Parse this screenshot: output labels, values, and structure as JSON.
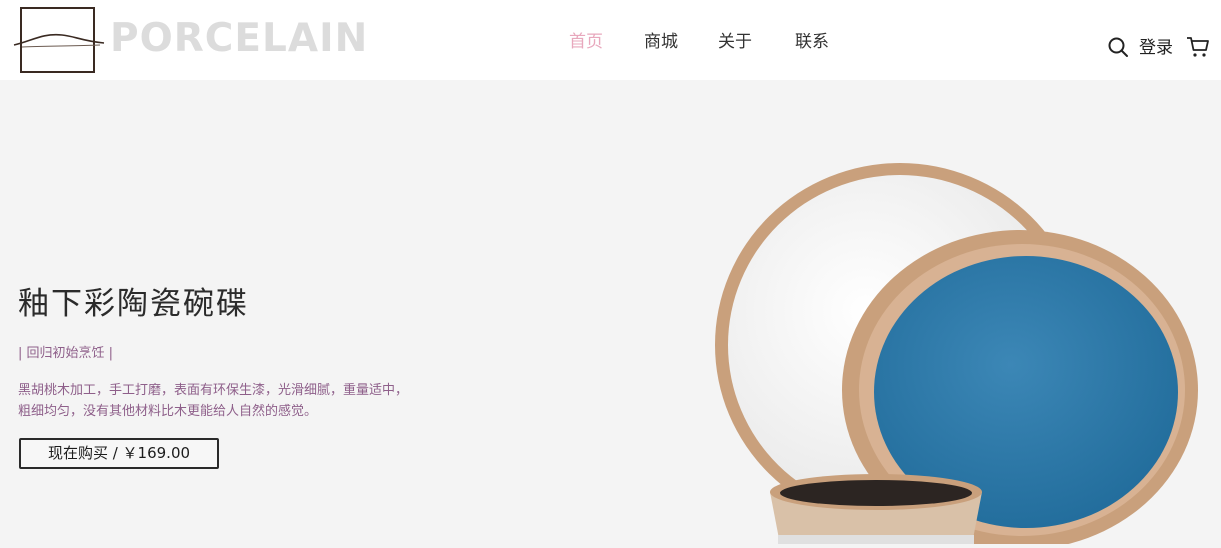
{
  "brand": {
    "logo_text": "PORCELAIN"
  },
  "nav": {
    "items": [
      {
        "label": "首页",
        "active": true
      },
      {
        "label": "商城",
        "active": false
      },
      {
        "label": "关于",
        "active": false
      },
      {
        "label": "联系",
        "active": false
      }
    ]
  },
  "header_actions": {
    "search_icon": "search-icon",
    "login_label": "登录",
    "cart_icon": "cart-icon"
  },
  "hero": {
    "title": "釉下彩陶瓷碗碟",
    "subtitle": "| 回归初始烹饪 |",
    "description": "黑胡桃木加工，手工打磨，表面有环保生漆，光滑细腻，重量适中，粗细均匀，没有其他材料比木更能给人自然的感觉。",
    "buy_button": "现在购买 / ￥169.00"
  },
  "colors": {
    "nav_active": "#e8a8bd",
    "accent_text": "#8e5f8a",
    "background": "#f4f4f4",
    "plate_blue": "#2f78a6",
    "plate_rim": "#c9a07c"
  }
}
